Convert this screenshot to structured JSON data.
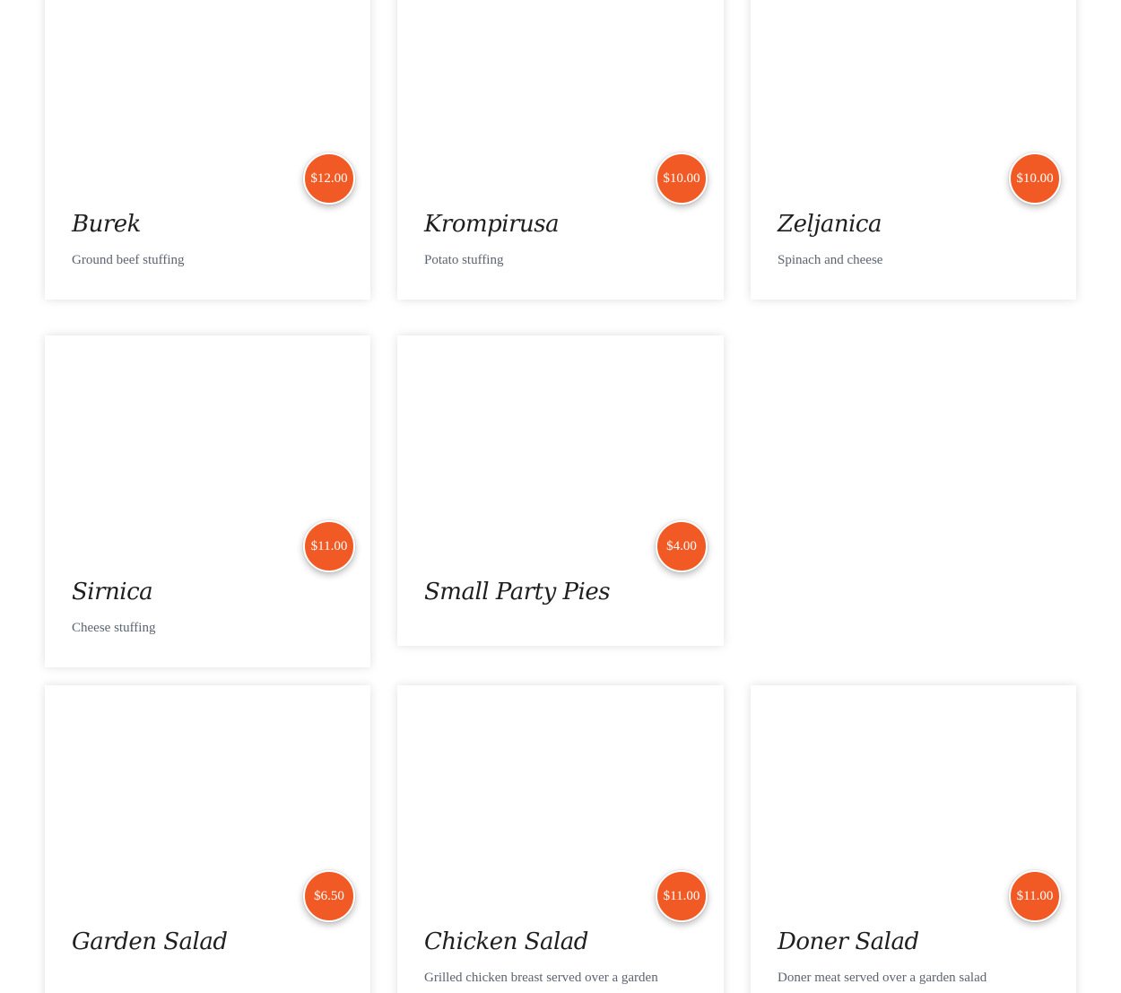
{
  "menu_items": [
    {
      "name": "Burek",
      "price": "$12.00",
      "description": "Ground beef stuffing"
    },
    {
      "name": "Krompirusa",
      "price": "$10.00",
      "description": "Potato stuffing"
    },
    {
      "name": "Zeljanica",
      "price": "$10.00",
      "description": "Spinach and cheese"
    },
    {
      "name": "Sirnica",
      "price": "$11.00",
      "description": "Cheese stuffing"
    },
    {
      "name": "Small Party Pies",
      "price": "$4.00",
      "description": ""
    },
    {
      "name": "Garden Salad",
      "price": "$6.50",
      "description": ""
    },
    {
      "name": "Chicken Salad",
      "price": "$11.00",
      "description": "Grilled chicken breast served over a garden"
    },
    {
      "name": "Doner Salad",
      "price": "$11.00",
      "description": "Doner meat served over a garden salad"
    }
  ],
  "colors": {
    "price_badge": "#f15a24",
    "title": "#1f1f1f",
    "description": "#5b6470"
  }
}
